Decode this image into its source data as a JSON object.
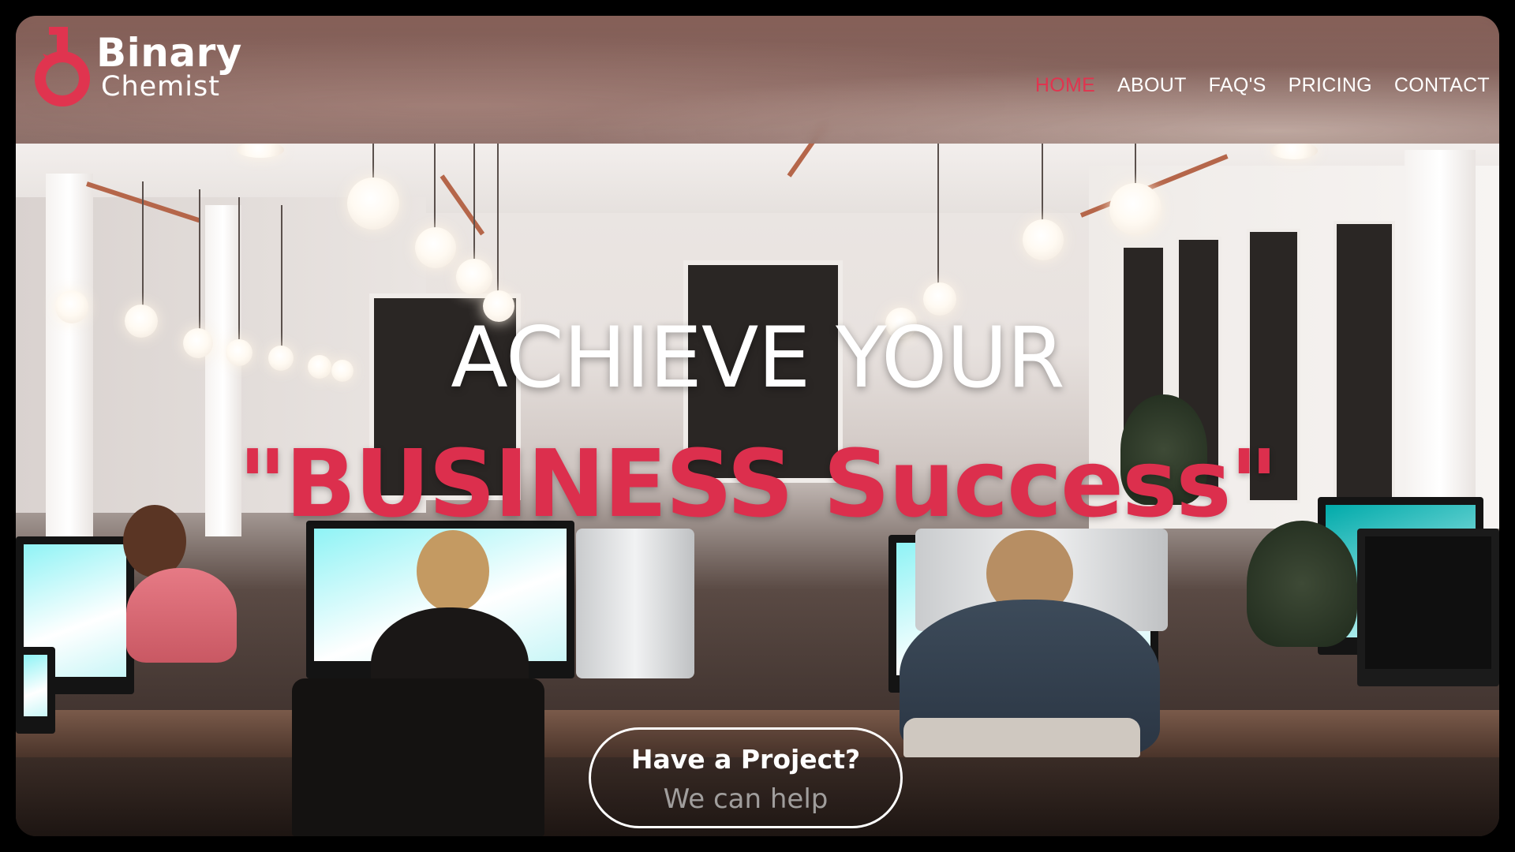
{
  "brand": {
    "name_line1": "Binary",
    "name_line2": "Chemist",
    "accent_color": "#e0344f"
  },
  "nav": {
    "items": [
      {
        "label": "HOME",
        "active": true
      },
      {
        "label": "ABOUT",
        "active": false
      },
      {
        "label": "FAQ'S",
        "active": false
      },
      {
        "label": "PRICING",
        "active": false
      },
      {
        "label": "CONTACT",
        "active": false
      }
    ]
  },
  "hero": {
    "headline": "ACHIEVE YOUR",
    "highlight": "\"BUSINESS Success\"",
    "background": "office-photo"
  },
  "cta": {
    "title": "Have a Project?",
    "subtitle": "We can help"
  }
}
